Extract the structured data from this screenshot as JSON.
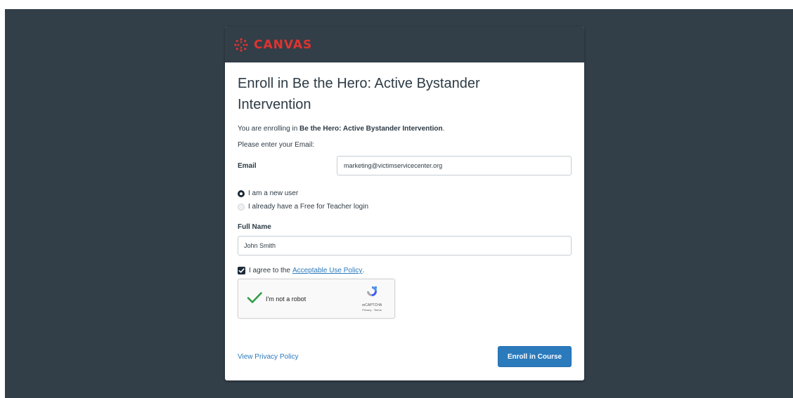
{
  "brand": {
    "name": "CANVAS",
    "color": "#e0332f",
    "header_bg": "#323e48",
    "logo_icon": "canvas-logo-icon"
  },
  "form": {
    "title": "Enroll in Be the Hero: Active Bystander Intervention",
    "intro_prefix": "You are enrolling in ",
    "intro_course": "Be the Hero: Active Bystander Intervention",
    "intro_suffix": ".",
    "email_prompt": "Please enter your Email:",
    "email_label": "Email",
    "email_value": "marketing@victimservicecenter.org",
    "radio_new_user": "I am a new user",
    "radio_existing": "I already have a Free for Teacher login",
    "selected_radio": "new_user",
    "full_name_label": "Full Name",
    "full_name_value": "John Smith",
    "agree_prefix": "I agree to the",
    "agree_link": "Acceptable Use Policy",
    "agree_suffix": ".",
    "agree_checked": true
  },
  "recaptcha": {
    "label": "I'm not a robot",
    "brand": "reCAPTCHA",
    "terms": "Privacy - Terms",
    "check_icon": "checkmark-icon"
  },
  "footer": {
    "privacy_link": "View Privacy Policy",
    "enroll_button": "Enroll in Course",
    "accent": "#2b7abc"
  }
}
